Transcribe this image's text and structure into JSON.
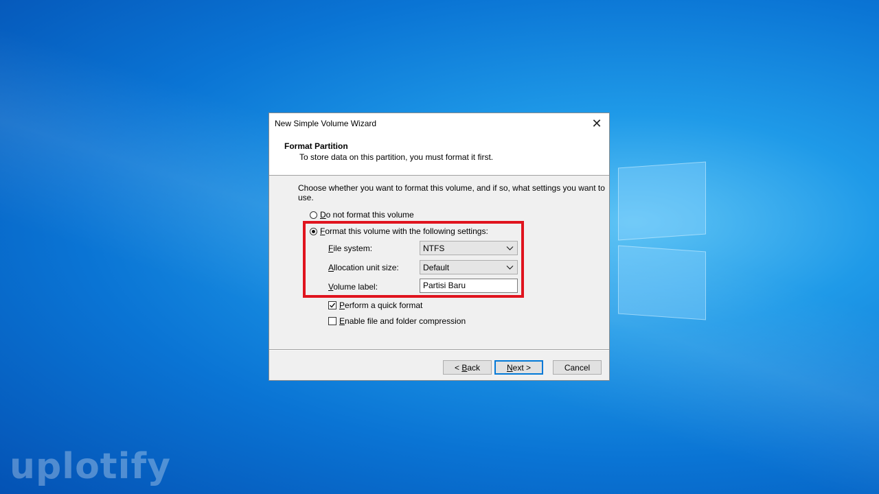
{
  "watermark": "uplotify",
  "dialog": {
    "title": "New Simple Volume Wizard",
    "close_glyph": "✕",
    "header_title": "Format Partition",
    "header_subtitle": "To store data on this partition, you must format it first.",
    "instruction": "Choose whether you want to format this volume, and if so, what settings you want to use.",
    "options": {
      "no_format": {
        "mnemonic": "D",
        "rest": "o not format this volume",
        "selected": false
      },
      "format": {
        "mnemonic": "F",
        "rest": "ormat this volume with the following settings:",
        "selected": true
      }
    },
    "file_system": {
      "mnemonic": "F",
      "rest": "ile system:",
      "value": "NTFS"
    },
    "allocation": {
      "mnemonic": "A",
      "rest": "llocation unit size:",
      "value": "Default"
    },
    "volume_label": {
      "mnemonic": "V",
      "rest": "olume label:",
      "value": "Partisi Baru"
    },
    "quick_format": {
      "mnemonic": "P",
      "rest": "erform a quick format",
      "checked": true
    },
    "compression": {
      "mnemonic": "E",
      "rest": "nable file and folder compression",
      "checked": false
    },
    "buttons": {
      "back": {
        "prefix": "< ",
        "mnemonic": "B",
        "rest": "ack"
      },
      "next": {
        "mnemonic": "N",
        "rest": "ext >"
      },
      "cancel": "Cancel"
    },
    "highlight_color": "#e0141e",
    "accent": "#0078d7"
  }
}
